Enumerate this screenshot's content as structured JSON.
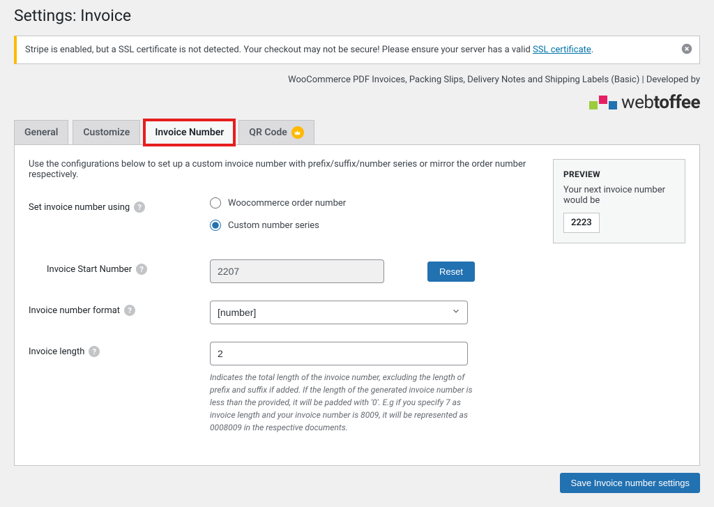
{
  "page_title": "Settings: Invoice",
  "notice": {
    "text_before": "Stripe is enabled, but a SSL certificate is not detected. Your checkout may not be secure! Please ensure your server has a valid ",
    "link_text": "SSL certificate",
    "text_after": "."
  },
  "developed_by": "WooCommerce PDF Invoices, Packing Slips, Delivery Notes and Shipping Labels (Basic) | Developed by",
  "brand": {
    "prefix": "web",
    "suffix": "toffee"
  },
  "tabs": {
    "general": "General",
    "customize": "Customize",
    "invoice_number": "Invoice Number",
    "qr_code": "QR Code"
  },
  "intro": "Use the configurations below to set up a custom invoice number with prefix/suffix/number series or mirror the order number respectively.",
  "labels": {
    "set_using": "Set invoice number using",
    "start_number": "Invoice Start Number",
    "format": "Invoice number format",
    "length": "Invoice length"
  },
  "radios": {
    "woo": "Woocommerce order number",
    "custom": "Custom number series"
  },
  "fields": {
    "start_number": "2207",
    "format": "[number]",
    "length": "2"
  },
  "buttons": {
    "reset": "Reset",
    "save": "Save Invoice number settings"
  },
  "length_desc": "Indicates the total length of the invoice number, excluding the length of prefix and suffix if added. If the length of the generated invoice number is less than the provided, it will be padded with '0'. E.g if you specify 7 as invoice length and your invoice number is 8009, it will be represented as 0008009 in the respective documents.",
  "preview": {
    "title": "PREVIEW",
    "text": "Your next invoice number would be",
    "value": "2223"
  }
}
